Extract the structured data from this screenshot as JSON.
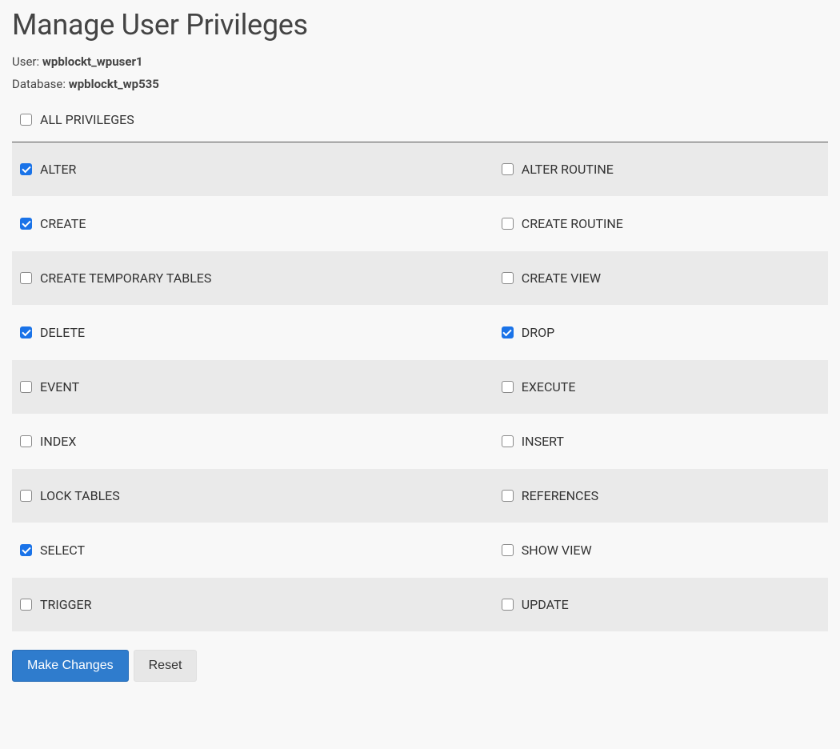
{
  "page": {
    "title": "Manage User Privileges"
  },
  "meta": {
    "user_label": "User:",
    "user_value": "wpblockt_wpuser1",
    "database_label": "Database:",
    "database_value": "wpblockt_wp535"
  },
  "all_privileges": {
    "label": "ALL PRIVILEGES",
    "checked": false
  },
  "privileges": [
    {
      "left": {
        "label": "ALTER",
        "checked": true
      },
      "right": {
        "label": "ALTER ROUTINE",
        "checked": false
      }
    },
    {
      "left": {
        "label": "CREATE",
        "checked": true
      },
      "right": {
        "label": "CREATE ROUTINE",
        "checked": false
      }
    },
    {
      "left": {
        "label": "CREATE TEMPORARY TABLES",
        "checked": false
      },
      "right": {
        "label": "CREATE VIEW",
        "checked": false
      }
    },
    {
      "left": {
        "label": "DELETE",
        "checked": true
      },
      "right": {
        "label": "DROP",
        "checked": true
      }
    },
    {
      "left": {
        "label": "EVENT",
        "checked": false
      },
      "right": {
        "label": "EXECUTE",
        "checked": false
      }
    },
    {
      "left": {
        "label": "INDEX",
        "checked": false
      },
      "right": {
        "label": "INSERT",
        "checked": false
      }
    },
    {
      "left": {
        "label": "LOCK TABLES",
        "checked": false
      },
      "right": {
        "label": "REFERENCES",
        "checked": false
      }
    },
    {
      "left": {
        "label": "SELECT",
        "checked": true
      },
      "right": {
        "label": "SHOW VIEW",
        "checked": false
      }
    },
    {
      "left": {
        "label": "TRIGGER",
        "checked": false
      },
      "right": {
        "label": "UPDATE",
        "checked": false
      }
    }
  ],
  "buttons": {
    "submit": "Make Changes",
    "reset": "Reset"
  }
}
